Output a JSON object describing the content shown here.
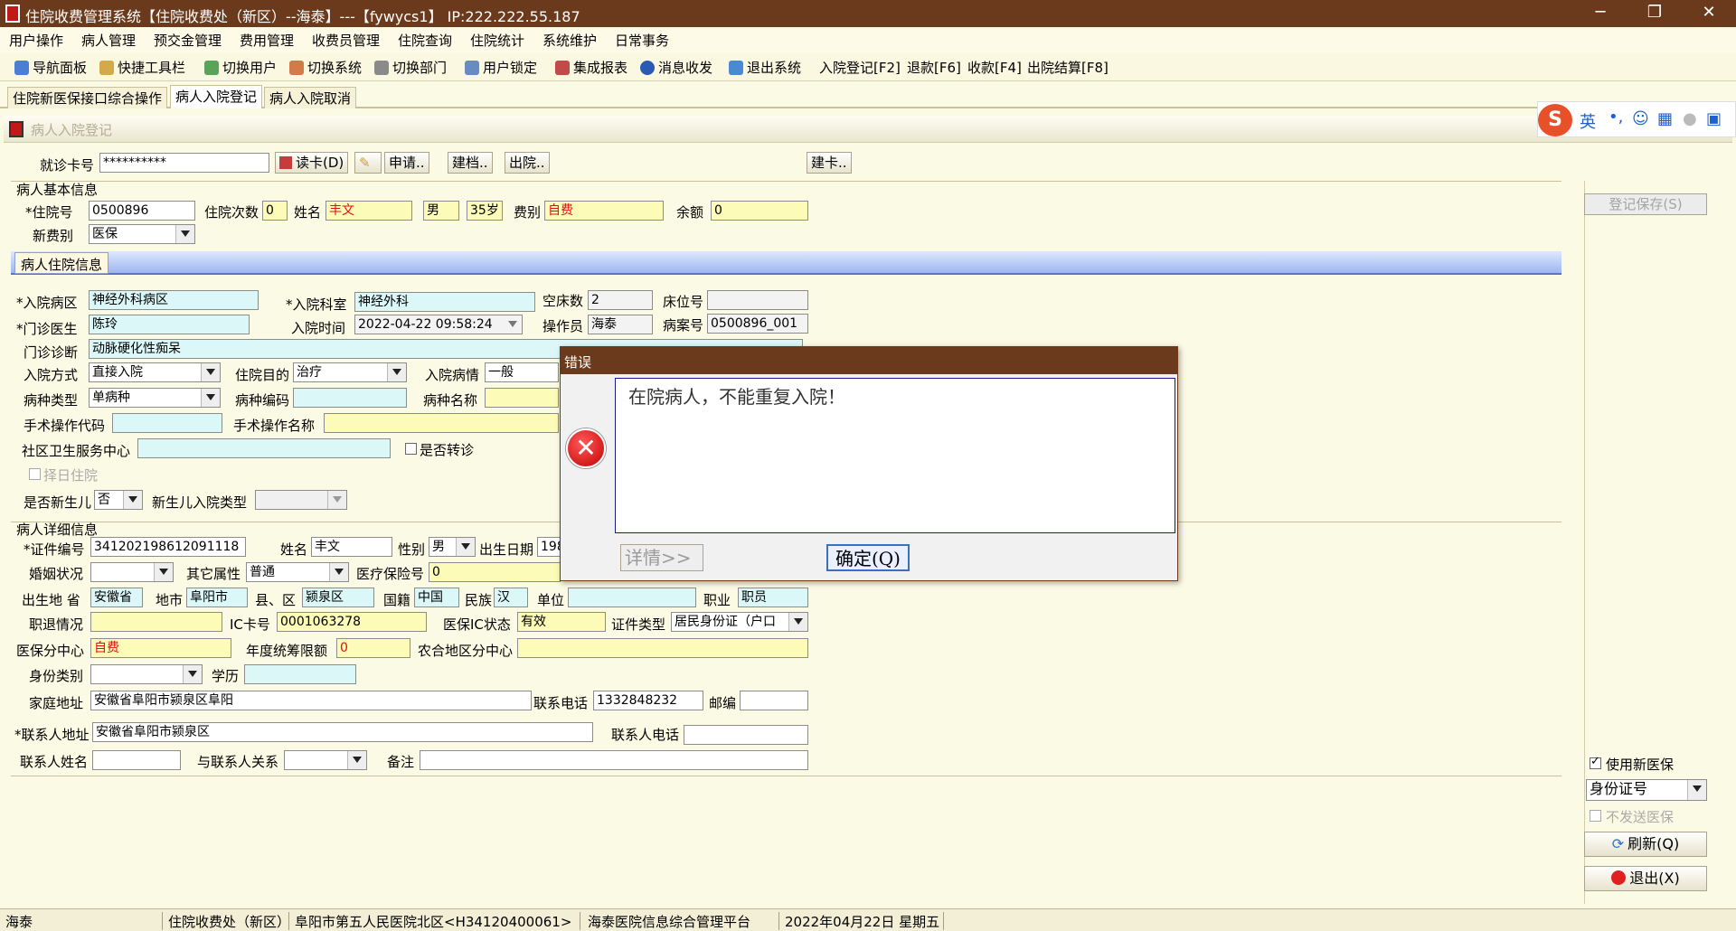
{
  "window": {
    "title": "住院收费管理系统【住院收费处（新区）--海泰】---【fywycs1】 IP:222.222.55.187"
  },
  "menu": [
    "用户操作",
    "病人管理",
    "预交金管理",
    "费用管理",
    "收费员管理",
    "住院查询",
    "住院统计",
    "系统维护",
    "日常事务"
  ],
  "toolbar": [
    "导航面板",
    "快捷工具栏",
    "切换用户",
    "切换系统",
    "切换部门",
    "用户锁定",
    "集成报表",
    "消息收发",
    "退出系统",
    "入院登记[F2]",
    "退款[F6]",
    "收款[F4]",
    "出院结算[F8]"
  ],
  "tabs": [
    "住院新医保接口综合操作",
    "病人入院登记",
    "病人入院取消"
  ],
  "subwindow_title": "病人入院登记",
  "ime": {
    "lang": "英"
  },
  "card_row": {
    "label": "就诊卡号",
    "value": "**********",
    "read_card": "读卡(D)",
    "apply": "申请..",
    "create": "建档..",
    "discharge": "出院..",
    "build_card": "建卡.."
  },
  "basic": {
    "section": "病人基本信息",
    "admission_no_label": "*住院号",
    "admission_no": "0500896",
    "times_label": "住院次数",
    "times": "0",
    "name_label": "姓名",
    "name": "丰文",
    "sex": "男",
    "age": "35岁",
    "fee_type_label": "费别",
    "fee_type": "自费",
    "balance_label": "余额",
    "balance": "0",
    "new_fee_type_label": "新费别",
    "new_fee_type": "医保"
  },
  "hosp": {
    "section": "病人住院信息",
    "ward_label": "*入院病区",
    "ward": "神经外科病区",
    "dept_label": "*入院科室",
    "dept": "神经外科",
    "empty_beds_label": "空床数",
    "empty_beds": "2",
    "bed_no_label": "床位号",
    "bed_no": "",
    "doctor_label": "*门诊医生",
    "doctor": "陈玲",
    "time_label": "入院时间",
    "time": "2022-04-22 09:58:24",
    "operator_label": "操作员",
    "operator": "海泰",
    "case_no_label": "病案号",
    "case_no": "0500896_001",
    "diagnosis_label": "门诊诊断",
    "diagnosis": "动脉硬化性痴呆",
    "mode_label": "入院方式",
    "mode": "直接入院",
    "purpose_label": "住院目的",
    "purpose": "治疗",
    "condition_label": "入院病情",
    "condition": "一般",
    "disease_type_label": "病种类型",
    "disease_type": "单病种",
    "disease_code_label": "病种编码",
    "disease_name_label": "病种名称",
    "op_code_label": "手术操作代码",
    "op_name_label": "手术操作名称",
    "community_label": "社区卫生服务中心",
    "transfer_label": "是否转诊",
    "select_day_label": "择日住院",
    "newborn_label": "是否新生儿",
    "newborn": "否",
    "newborn_type_label": "新生儿入院类型"
  },
  "detail": {
    "section": "病人详细信息",
    "id_label": "*证件编号",
    "id": "341202198612091118",
    "name_label": "姓名",
    "name": "丰文",
    "sex_label": "性别",
    "sex": "男",
    "birth_label": "出生日期",
    "birth": "198",
    "marital_label": "婚姻状况",
    "other_label": "其它属性",
    "other": "普通",
    "insurance_label": "医疗保险号",
    "insurance": "0",
    "birthplace_label": "出生地 省",
    "province": "安徽省",
    "city_label": "地市",
    "city": "阜阳市",
    "county_label": "县、区",
    "county": "颍泉区",
    "nation_label": "国籍",
    "nation": "中国",
    "ethnic_label": "民族",
    "ethnic": "汉",
    "unit_label": "单位",
    "job_label": "职业",
    "job": "职员",
    "retire_label": "职退情况",
    "ic_label": "IC卡号",
    "ic": "0001063278",
    "ic_status_label": "医保IC状态",
    "ic_status": "有效",
    "cert_type_label": "证件类型",
    "cert_type": "居民身份证（户口",
    "center_label": "医保分中心",
    "center": "自费",
    "annual_label": "年度统筹限额",
    "annual": "0",
    "rural_label": "农合地区分中心",
    "identity_label": "身份类别",
    "edu_label": "学历",
    "address_label": "家庭地址",
    "address": "安徽省阜阳市颍泉区阜阳",
    "phone_label": "联系电话",
    "phone": "1332848232",
    "zip_label": "邮编",
    "contact_addr_label": "*联系人地址",
    "contact_addr": "安徽省阜阳市颍泉区",
    "contact_phone_label": "联系人电话",
    "contact_name_label": "联系人姓名",
    "relation_label": "与联系人关系",
    "note_label": "备注"
  },
  "right": {
    "save": "登记保存(S)",
    "use_new_ins": "使用新医保",
    "id_type": "身份证号",
    "no_send": "不发送医保",
    "refresh": "刷新(Q)",
    "exit": "退出(X)"
  },
  "dialog": {
    "title": "错误",
    "message": "在院病人，不能重复入院！",
    "details": "详情>>",
    "ok": "确定(Q)"
  },
  "status": [
    "海泰",
    "住院收费处（新区）",
    "阜阳市第五人民医院北区<H34120400061>",
    "海泰医院信息综合管理平台",
    "2022年04月22日 星期五"
  ]
}
